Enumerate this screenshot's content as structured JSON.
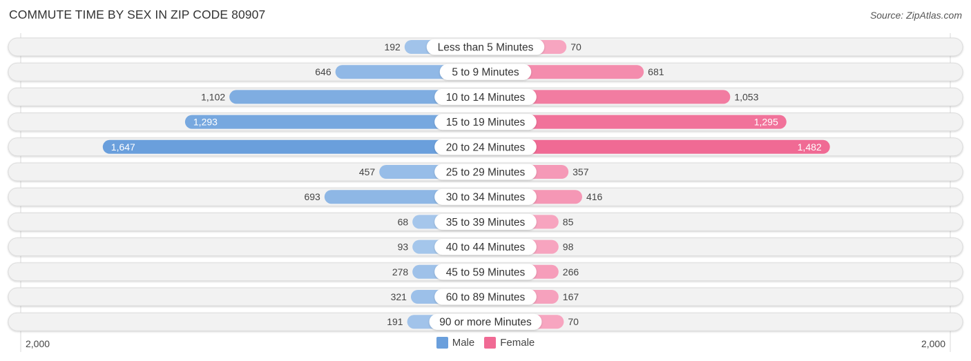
{
  "title": "COMMUTE TIME BY SEX IN ZIP CODE 80907",
  "source": "Source: ZipAtlas.com",
  "colors": {
    "male_light": "#a8c8ec",
    "male_dark": "#6a9fdc",
    "female_light": "#f7a8c2",
    "female_dark": "#f06a94",
    "row_bg": "#f2f2f2"
  },
  "legend": {
    "male": "Male",
    "female": "Female"
  },
  "axis": {
    "left_label": "2,000",
    "right_label": "2,000"
  },
  "chart_data": {
    "type": "bar",
    "orientation": "horizontal-diverging",
    "title": "COMMUTE TIME BY SEX IN ZIP CODE 80907",
    "categories": [
      "Less than 5 Minutes",
      "5 to 9 Minutes",
      "10 to 14 Minutes",
      "15 to 19 Minutes",
      "20 to 24 Minutes",
      "25 to 29 Minutes",
      "30 to 34 Minutes",
      "35 to 39 Minutes",
      "40 to 44 Minutes",
      "45 to 59 Minutes",
      "60 to 89 Minutes",
      "90 or more Minutes"
    ],
    "series": [
      {
        "name": "Male",
        "side": "left",
        "values": [
          192,
          646,
          1102,
          1293,
          1647,
          457,
          693,
          68,
          93,
          278,
          321,
          191
        ],
        "labels": [
          "192",
          "646",
          "1,102",
          "1,293",
          "1,647",
          "457",
          "693",
          "68",
          "93",
          "278",
          "321",
          "191"
        ]
      },
      {
        "name": "Female",
        "side": "right",
        "values": [
          70,
          681,
          1053,
          1295,
          1482,
          357,
          416,
          85,
          98,
          266,
          167,
          70
        ],
        "labels": [
          "70",
          "681",
          "1,053",
          "1,295",
          "1,482",
          "357",
          "416",
          "85",
          "98",
          "266",
          "167",
          "70"
        ]
      }
    ],
    "xlim": [
      -2000,
      2000
    ],
    "xtick_labels": [
      "2,000",
      "2,000"
    ],
    "legend_position": "bottom-center",
    "grid": false
  }
}
